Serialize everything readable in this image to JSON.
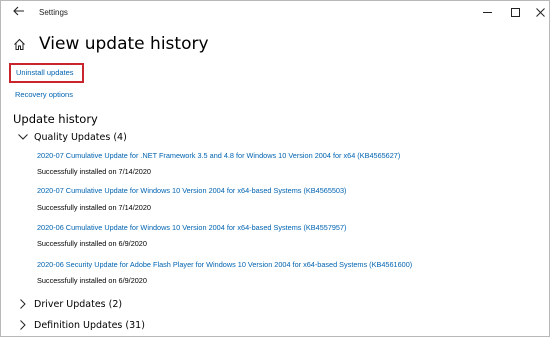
{
  "window": {
    "title": "Settings",
    "controls": [
      "minimize",
      "maximize",
      "close"
    ]
  },
  "header": {
    "title": "View update history",
    "home_icon": "home-icon",
    "back_icon": "back-arrow-icon"
  },
  "links": {
    "uninstall": "Uninstall updates",
    "recovery": "Recovery options"
  },
  "colors": {
    "link": "#0063b1",
    "highlight_box": "#c8262c"
  },
  "update_history": {
    "title": "Update history",
    "groups": [
      {
        "label": "Quality Updates (4)",
        "expanded": true,
        "items": [
          {
            "title": "2020-07 Cumulative Update for .NET Framework 3.5 and 4.8 for Windows 10 Version 2004 for x64 (KB4565627)",
            "status": "Successfully installed on 7/14/2020"
          },
          {
            "title": "2020-07 Cumulative Update for Windows 10 Version 2004 for x64-based Systems (KB4565503)",
            "status": "Successfully installed on 7/14/2020"
          },
          {
            "title": "2020-06 Cumulative Update for Windows 10 Version 2004 for x64-based Systems (KB4557957)",
            "status": "Successfully installed on 6/9/2020"
          },
          {
            "title": "2020-06 Security Update for Adobe Flash Player for Windows 10 Version 2004 for x64-based Systems (KB4561600)",
            "status": "Successfully installed on 6/9/2020"
          }
        ]
      },
      {
        "label": "Driver Updates (2)",
        "expanded": false
      },
      {
        "label": "Definition Updates (31)",
        "expanded": false
      }
    ]
  }
}
